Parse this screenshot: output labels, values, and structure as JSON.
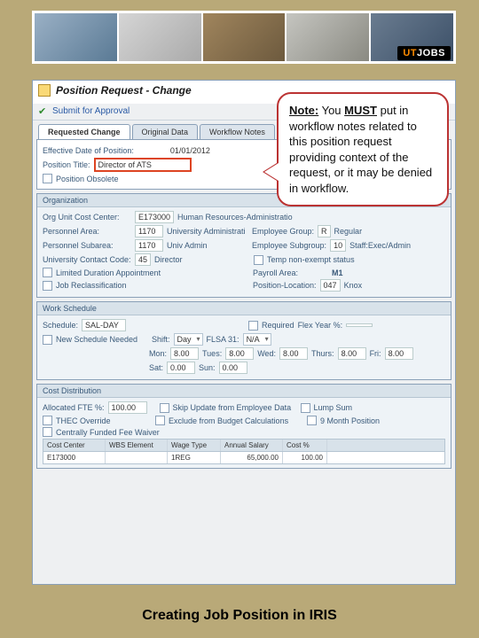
{
  "banner": {
    "logo_prefix": "UT",
    "logo_suffix": "JOBS"
  },
  "callout": {
    "note_label": "Note:",
    "text_before": " You ",
    "must": "MUST",
    "text_after": " put in workflow notes related to this position request providing context of the request, or it may be denied in workflow."
  },
  "app": {
    "title": "Position Request - Change",
    "submit": "Submit for Approval",
    "tabs": [
      "Requested Change",
      "Original Data",
      "Workflow Notes"
    ],
    "basic": {
      "eff_label": "Effective Date of Position:",
      "eff_value": "01/01/2012",
      "pos_title_label": "Position Title:",
      "pos_title_value": "Director of ATS",
      "pos_obsolete": "Position Obsolete"
    },
    "org": {
      "section": "Organization",
      "org_unit_label": "Org Unit Cost Center:",
      "org_unit_value": "E173000",
      "org_unit_desc": "Human Resources-Administratio",
      "pa_label": "Personnel Area:",
      "pa_value": "1170",
      "pa_desc": "University Administrati",
      "eg_label": "Employee Group:",
      "eg_value": "R",
      "eg_desc": "Regular",
      "ps_label": "Personnel Subarea:",
      "ps_value": "1170",
      "ps_desc": "Univ Admin",
      "es_label": "Employee Subgroup:",
      "es_value": "10",
      "es_desc": "Staff:Exec/Admin",
      "uc_label": "University Contact Code:",
      "uc_value": "45",
      "uc_desc": "Director",
      "temp_ne": "Temp non-exempt status",
      "lda": "Limited Duration Appointment",
      "payroll_label": "Payroll Area:",
      "payroll_value": "M1",
      "jr": "Job Reclassification",
      "pl_label": "Position-Location:",
      "pl_value": "047",
      "pl_desc": "Knox"
    },
    "ws": {
      "section": "Work Schedule",
      "sched_label": "Schedule:",
      "sched_value": "SAL-DAY",
      "req": "Required",
      "flex_label": "Flex Year %:",
      "flex_value": "",
      "newsched": "New Schedule Needed",
      "shift_label": "Shift:",
      "shift_value": "Day",
      "flsa_label": "FLSA 31:",
      "flsa_value": "N/A",
      "days": {
        "mon_l": "Mon:",
        "mon": "8.00",
        "tue_l": "Tues:",
        "tue": "8.00",
        "wed_l": "Wed:",
        "wed": "8.00",
        "thu_l": "Thurs:",
        "thu": "8.00",
        "fri_l": "Fri:",
        "fri": "8.00",
        "sat_l": "Sat:",
        "sat": "0.00",
        "sun_l": "Sun:",
        "sun": "0.00"
      }
    },
    "cd": {
      "section": "Cost Distribution",
      "fte_label": "Allocated FTE %:",
      "fte_value": "100.00",
      "skip": "Skip Update from Employee Data",
      "lump": "Lump Sum",
      "thec": "THEC Override",
      "exclude": "Exclude from Budget Calculations",
      "nine": "9 Month Position",
      "cfw": "Centrally Funded Fee Waiver",
      "cols": [
        "Cost Center",
        "WBS Element",
        "Wage Type",
        "Annual Salary",
        "Cost %"
      ],
      "row": [
        "E173000",
        "",
        "1REG",
        "65,000.00",
        "100.00"
      ]
    }
  },
  "caption": "Creating Job Position in IRIS"
}
